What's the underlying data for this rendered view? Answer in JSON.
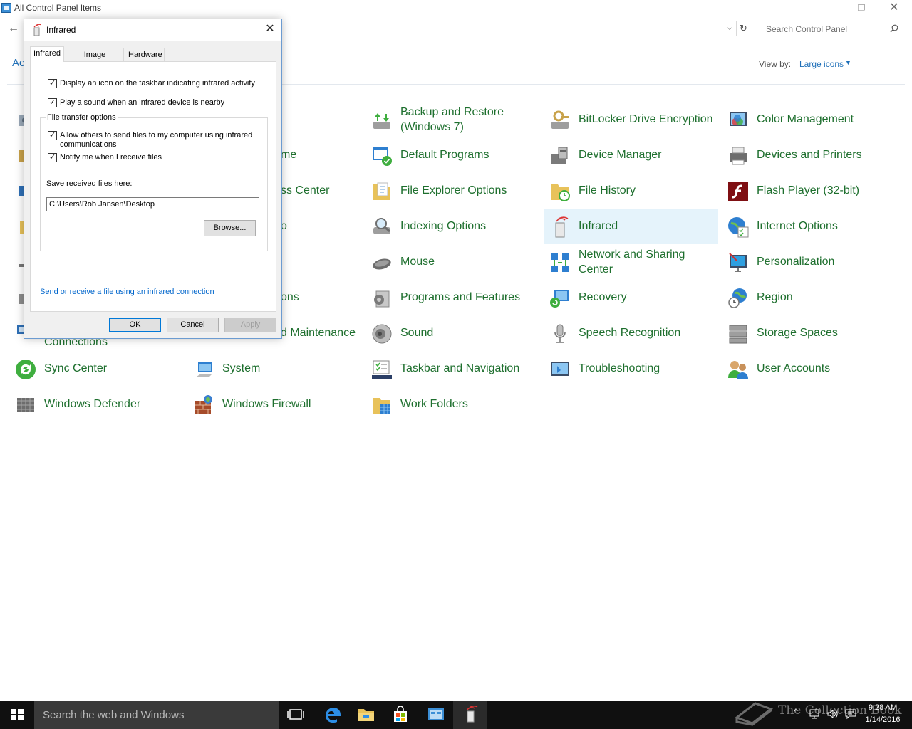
{
  "window": {
    "title": "All Control Panel Items",
    "search_placeholder": "Search Control Panel"
  },
  "header": {
    "adjust_label": "Ac",
    "view_by_label": "View by:",
    "view_by_value": "Large icons"
  },
  "items": [
    {
      "label": "Backup and Restore (Windows 7)",
      "icon": "backup-restore-icon"
    },
    {
      "label": "BitLocker Drive Encryption",
      "icon": "bitlocker-icon"
    },
    {
      "label": "Color Management",
      "icon": "color-management-icon"
    },
    {
      "label": "me",
      "icon": "partial-icon"
    },
    {
      "label": "Default Programs",
      "icon": "default-programs-icon"
    },
    {
      "label": "Device Manager",
      "icon": "device-manager-icon"
    },
    {
      "label": "Devices and Printers",
      "icon": "devices-printers-icon"
    },
    {
      "label": "ss Center",
      "icon": "partial-icon"
    },
    {
      "label": "File Explorer Options",
      "icon": "file-explorer-options-icon"
    },
    {
      "label": "File History",
      "icon": "file-history-icon"
    },
    {
      "label": "Flash Player (32-bit)",
      "icon": "flash-player-icon"
    },
    {
      "label": "o",
      "icon": "partial-icon"
    },
    {
      "label": "Indexing Options",
      "icon": "indexing-options-icon"
    },
    {
      "label": "Infrared",
      "icon": "infrared-icon"
    },
    {
      "label": "Internet Options",
      "icon": "internet-options-icon"
    },
    {
      "label": "Mouse",
      "icon": "mouse-icon"
    },
    {
      "label": "Network and Sharing Center",
      "icon": "network-sharing-icon"
    },
    {
      "label": "Personalization",
      "icon": "personalization-icon"
    },
    {
      "label": "ons",
      "icon": "partial-icon"
    },
    {
      "label": "Programs and Features",
      "icon": "programs-features-icon"
    },
    {
      "label": "Recovery",
      "icon": "recovery-icon"
    },
    {
      "label": "Region",
      "icon": "region-icon"
    },
    {
      "label": "Connections",
      "icon": "connections-icon"
    },
    {
      "label": "d Maintenance",
      "icon": "partial-icon"
    },
    {
      "label": "Sound",
      "icon": "sound-icon"
    },
    {
      "label": "Speech Recognition",
      "icon": "speech-recognition-icon"
    },
    {
      "label": "Storage Spaces",
      "icon": "storage-spaces-icon"
    },
    {
      "label": "Sync Center",
      "icon": "sync-center-icon"
    },
    {
      "label": "System",
      "icon": "system-icon"
    },
    {
      "label": "Taskbar and Navigation",
      "icon": "taskbar-navigation-icon"
    },
    {
      "label": "Troubleshooting",
      "icon": "troubleshooting-icon"
    },
    {
      "label": "User Accounts",
      "icon": "user-accounts-icon"
    },
    {
      "label": "Windows Defender",
      "icon": "windows-defender-icon"
    },
    {
      "label": "Windows Firewall",
      "icon": "windows-firewall-icon"
    },
    {
      "label": "Work Folders",
      "icon": "work-folders-icon"
    }
  ],
  "dialog": {
    "title": "Infrared",
    "tabs": [
      "Infrared",
      "Image Transfer",
      "Hardware"
    ],
    "active_tab": "Infrared",
    "options": {
      "taskbar_icon": "Display an icon on the taskbar indicating infrared activity",
      "sound": "Play a sound when an infrared device is nearby"
    },
    "file_transfer": {
      "group_label": "File transfer options",
      "allow_line1": "Allow others to send files to my computer using infrared",
      "allow_line2": "communications",
      "notify": "Notify me when I receive files",
      "save_label": "Save received files here:",
      "save_path": "C:\\Users\\Rob Jansen\\Desktop",
      "browse": "Browse..."
    },
    "link": "Send or receive a file using an infrared connection",
    "buttons": {
      "ok": "OK",
      "cancel": "Cancel",
      "apply": "Apply"
    }
  },
  "taskbar": {
    "search_placeholder": "Search the web and Windows",
    "time": "9:28 AM",
    "date": "1/14/2016"
  },
  "watermark": "The Collection Book",
  "colors": {
    "link_green": "#1e6f2e",
    "link_blue": "#1e6fb8",
    "selected_bg": "#e5f3fb",
    "taskbar": "#101010"
  }
}
